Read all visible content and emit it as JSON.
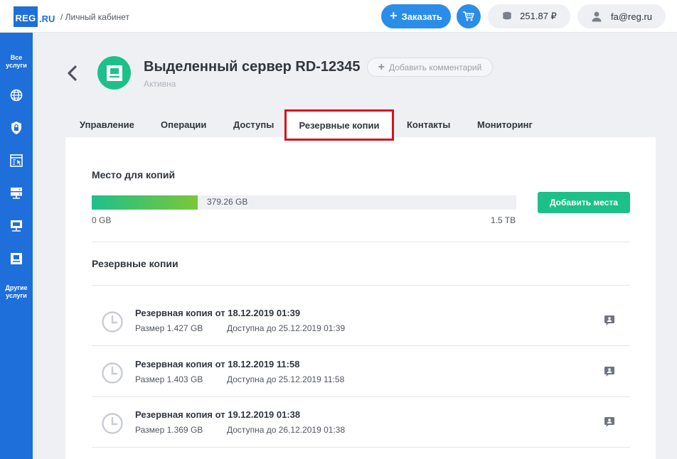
{
  "header": {
    "logo_main": "REG",
    "logo_suffix": ".RU",
    "breadcrumb": "/ Личный кабинет",
    "order_label": "Заказать",
    "balance": "251.87 ₽",
    "user_email": "fa@reg.ru"
  },
  "sidebar": {
    "all_services": [
      "Все",
      "услуги"
    ],
    "other_services": [
      "Другие",
      "услуги"
    ],
    "icons": [
      "globe-icon",
      "lock-shield-icon",
      "hosting-window-icon",
      "server-icon",
      "vps-icon",
      "dedicated-server-icon"
    ]
  },
  "page": {
    "title": "Выделенный сервер RD-12345",
    "status": "Активна",
    "add_comment_label": "Добавить комментарий"
  },
  "tabs": [
    {
      "label": "Управление"
    },
    {
      "label": "Операции"
    },
    {
      "label": "Доступы"
    },
    {
      "label": "Резервные копии",
      "active": true
    },
    {
      "label": "Контакты"
    },
    {
      "label": "Мониторинг"
    }
  ],
  "storage": {
    "title": "Место для копий",
    "used_label": "379.26 GB",
    "used_fraction": 0.25,
    "min_label": "0 GB",
    "max_label": "1.5 TB",
    "add_button": "Добавить места"
  },
  "backups": {
    "title": "Резервные копии",
    "items": [
      {
        "title": "Резервная копия от 18.12.2019 01:39",
        "size": "Размер 1.427 GB",
        "until": "Доступна до 25.12.2019 01:39"
      },
      {
        "title": "Резервная копия от 18.12.2019 11:58",
        "size": "Размер 1.403 GB",
        "until": "Доступна до 25.12.2019 11:58"
      },
      {
        "title": "Резервная копия от 19.12.2019 01:38",
        "size": "Размер 1.369 GB",
        "until": "Доступна до 26.12.2019 01:38"
      }
    ]
  },
  "colors": {
    "brand_blue": "#1e6fd9",
    "accent_blue": "#2a8de8",
    "green": "#1ec08a",
    "highlight_red": "#d6121b"
  }
}
